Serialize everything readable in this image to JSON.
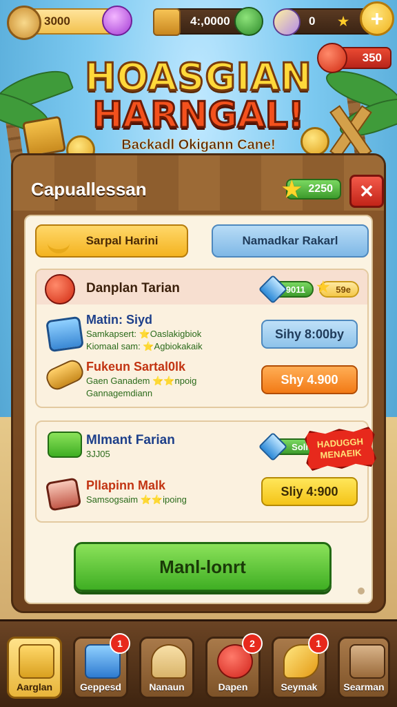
{
  "resources": {
    "wood": "3000",
    "crates": "4:,0000",
    "potions": "0"
  },
  "apple_counter": "350",
  "title": {
    "line1": "HOASGIAN",
    "line2": "HARNGAL!",
    "subtitle": "Backadl Okigann Cane!"
  },
  "panel": {
    "title": "Capuallessan",
    "stars": "2250"
  },
  "tabs": {
    "left": "Sarpal Harini",
    "right": "Namadkar Rakarl"
  },
  "group1": {
    "header_title": "Danplan Tarian",
    "header_pill_green": "9011",
    "header_pill_yellow": "59e",
    "row1": {
      "title": "Matin: Siyd",
      "line1": "Samkapsert: ⭐Oaslakigbiok",
      "line2": "Kiomaal sam: ⭐Agbiokakaik",
      "button": "Sihy 8:00by"
    },
    "row2": {
      "title": "Fukeun Sartal0lk",
      "line1": "Gaen Ganadem ⭐⭐npoig",
      "line2": "Gannagemdiann",
      "button": "Shy 4.900"
    }
  },
  "group2": {
    "row1": {
      "title": "Mlmant Farian",
      "line1": "3JJ05",
      "pill": "Soli",
      "badge": "HADUGGH MENAEIK"
    },
    "row2": {
      "title": "Pllapinn Malk",
      "line1": "Samsogsaim ⭐⭐ipoing",
      "button": "Sliy 4:900"
    }
  },
  "main_button": "Manl-lonrt",
  "nav": [
    {
      "label": "Aarglan",
      "badge": ""
    },
    {
      "label": "Geppesd",
      "badge": "1"
    },
    {
      "label": "Nanaun",
      "badge": ""
    },
    {
      "label": "Dapen",
      "badge": "2"
    },
    {
      "label": "Seymak",
      "badge": "1"
    },
    {
      "label": "Searman",
      "badge": ""
    }
  ],
  "colors": {
    "accent_green": "#3fae23",
    "accent_orange": "#f27a16",
    "wood": "#8b5a2b",
    "close_red": "#c22418"
  }
}
